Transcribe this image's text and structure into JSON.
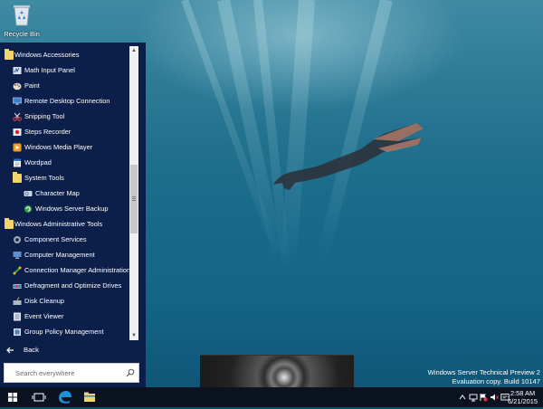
{
  "desktop": {
    "recycle_bin_label": "Recycle Bin"
  },
  "start_menu": {
    "items": [
      {
        "label": "Windows Accessories",
        "icon": "folder-icon",
        "level": 0
      },
      {
        "label": "Math Input Panel",
        "icon": "math-input-icon",
        "level": 1
      },
      {
        "label": "Paint",
        "icon": "paint-icon",
        "level": 1
      },
      {
        "label": "Remote Desktop Connection",
        "icon": "remote-desktop-icon",
        "level": 1
      },
      {
        "label": "Snipping Tool",
        "icon": "scissors-icon",
        "level": 1
      },
      {
        "label": "Steps Recorder",
        "icon": "steps-recorder-icon",
        "level": 1
      },
      {
        "label": "Windows Media Player",
        "icon": "media-player-icon",
        "level": 1
      },
      {
        "label": "Wordpad",
        "icon": "wordpad-icon",
        "level": 1
      },
      {
        "label": "System Tools",
        "icon": "folder-icon",
        "level": 1
      },
      {
        "label": "Character Map",
        "icon": "character-map-icon",
        "level": 2
      },
      {
        "label": "Windows Server Backup",
        "icon": "server-backup-icon",
        "level": 2
      },
      {
        "label": "Windows Administrative Tools",
        "icon": "folder-icon",
        "level": 0
      },
      {
        "label": "Component Services",
        "icon": "component-services-icon",
        "level": 1
      },
      {
        "label": "Computer Management",
        "icon": "computer-management-icon",
        "level": 1
      },
      {
        "label": "Connection Manager Administration",
        "icon": "connection-manager-icon",
        "level": 1
      },
      {
        "label": "Defragment and Optimize Drives",
        "icon": "defrag-icon",
        "level": 1
      },
      {
        "label": "Disk Cleanup",
        "icon": "disk-cleanup-icon",
        "level": 1
      },
      {
        "label": "Event Viewer",
        "icon": "event-viewer-icon",
        "level": 1
      },
      {
        "label": "Group Policy Management",
        "icon": "group-policy-icon",
        "level": 1
      }
    ],
    "back_label": "Back",
    "search_placeholder": "Search everywhere"
  },
  "watermark": {
    "line1": "Windows Server Technical Preview 2",
    "line2": "Evaluation copy. Build 10147"
  },
  "taskbar": {
    "time": "2:58 AM",
    "date": "6/21/2015"
  },
  "colors": {
    "start_bg": "#0b1f4a",
    "taskbar_bg": "#0b1220",
    "folder": "#f3d36b",
    "edge_blue": "#1e90d8"
  }
}
